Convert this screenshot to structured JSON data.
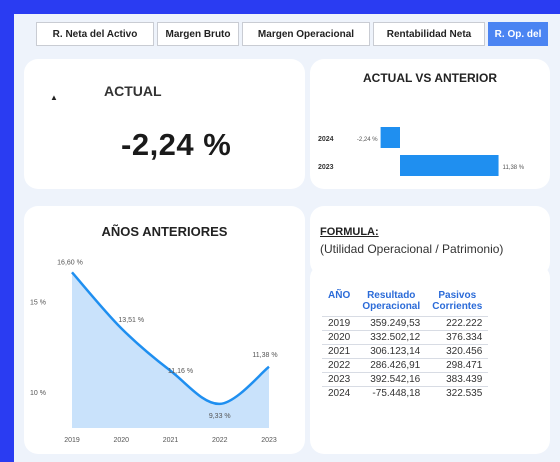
{
  "tabs": [
    {
      "label": "R. Neta del Activo",
      "w": 118
    },
    {
      "label": "Margen Bruto",
      "w": 82
    },
    {
      "label": "Margen Operacional",
      "w": 128
    },
    {
      "label": "Rentabilidad Neta",
      "w": 112
    },
    {
      "label": "R. Op. del",
      "w": 60,
      "active": true
    }
  ],
  "actual": {
    "label": "ACTUAL",
    "value": "-2,24 %"
  },
  "comparison": {
    "title": "ACTUAL VS ANTERIOR",
    "chart_data": {
      "type": "bar",
      "orientation": "horizontal",
      "categories": [
        "2024",
        "2023"
      ],
      "values": [
        -2.24,
        11.38
      ],
      "data_labels": [
        "-2,24 %",
        "11,38 %"
      ],
      "color": "#1f8ff0"
    }
  },
  "previous": {
    "title": "AÑOS ANTERIORES",
    "chart_data": {
      "type": "area",
      "x": [
        "2019",
        "2020",
        "2021",
        "2022",
        "2023"
      ],
      "values": [
        16.6,
        13.51,
        11.16,
        9.33,
        11.38
      ],
      "data_labels": [
        "16,60 %",
        "13,51 %",
        "11,16 %",
        "9,33 %",
        "11,38 %"
      ],
      "yticks": [
        {
          "value": 15,
          "label": "15 %"
        },
        {
          "value": 10,
          "label": "10 %"
        }
      ],
      "ylim": [
        8,
        17.5
      ],
      "line_color": "#1f8ff0",
      "fill_color": "#c9e2fb"
    }
  },
  "formula": {
    "title": "FORMULA:",
    "text": "(Utilidad Operacional / Patrimonio)"
  },
  "table": {
    "headers": [
      "AÑO",
      "Resultado Operacional",
      "Pasivos Corrientes"
    ],
    "rows": [
      [
        "2019",
        "359.249,53",
        "222.222"
      ],
      [
        "2020",
        "332.502,12",
        "376.334"
      ],
      [
        "2021",
        "306.123,14",
        "320.456"
      ],
      [
        "2022",
        "286.426,91",
        "298.471"
      ],
      [
        "2023",
        "392.542,16",
        "383.439"
      ],
      [
        "2024",
        "-75.448,18",
        "322.535"
      ]
    ]
  }
}
